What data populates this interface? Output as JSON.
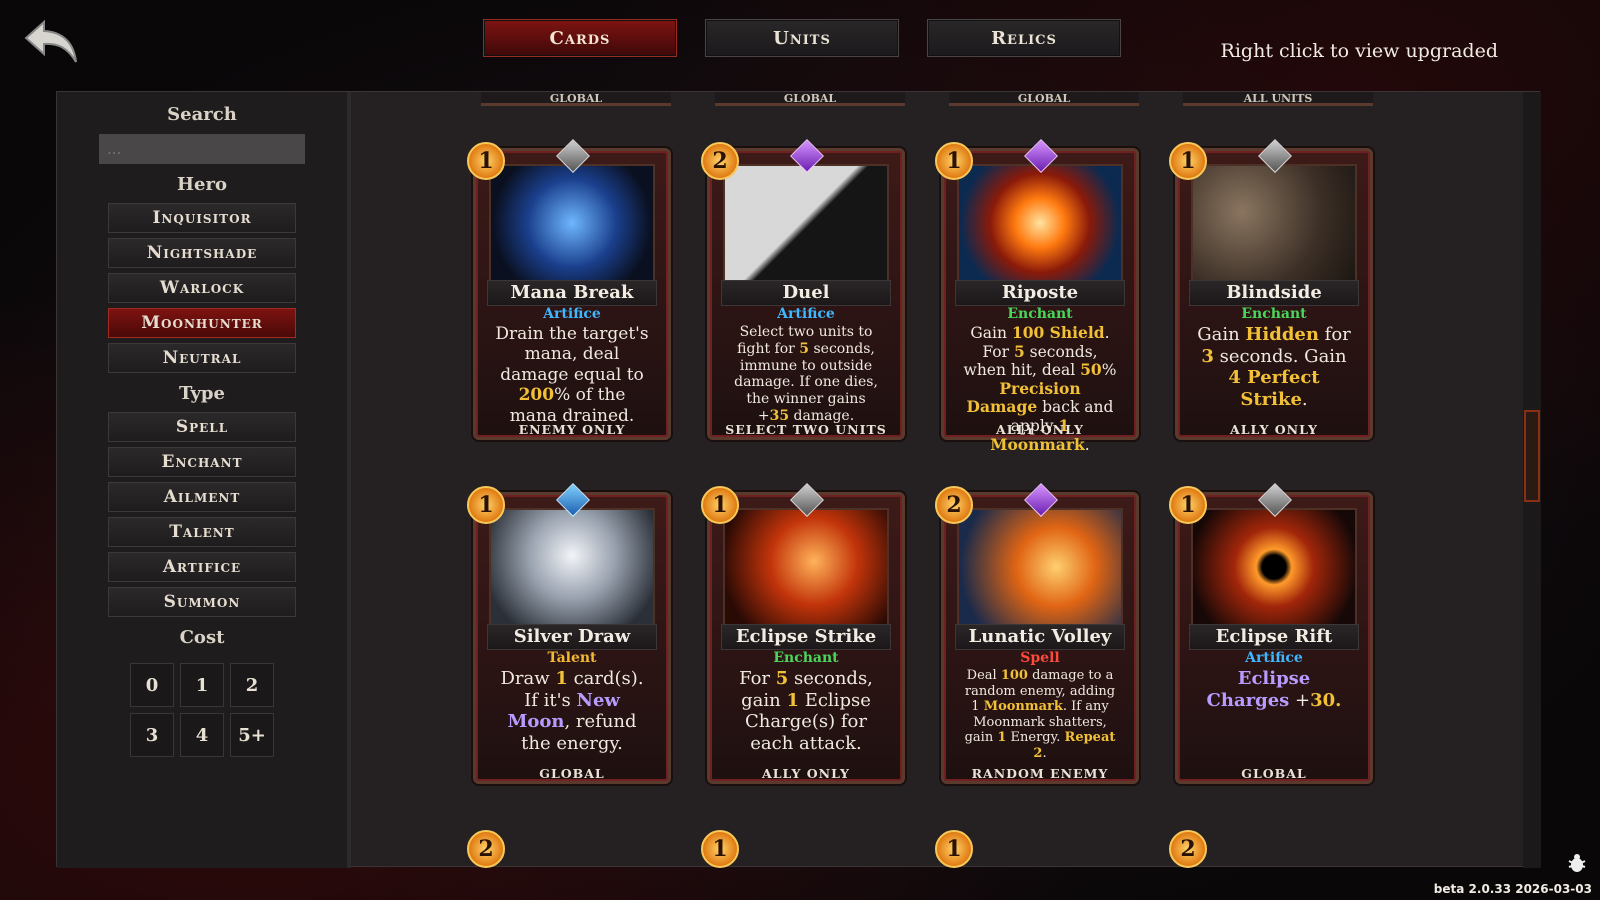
{
  "nav": {
    "tabs": [
      {
        "label": "Cards",
        "active": true
      },
      {
        "label": "Units",
        "active": false
      },
      {
        "label": "Relics",
        "active": false
      }
    ],
    "hint": "Right click to view upgraded"
  },
  "sidebar": {
    "search_label": "Search",
    "search_placeholder": "...",
    "hero_label": "Hero",
    "heroes": [
      "Inquisitor",
      "Nightshade",
      "Warlock",
      "Moonhunter",
      "Neutral"
    ],
    "active_hero": "Moonhunter",
    "type_label": "Type",
    "types": [
      "Spell",
      "Enchant",
      "Ailment",
      "Talent",
      "Artifice",
      "Summon"
    ],
    "cost_label": "Cost",
    "costs": [
      "0",
      "1",
      "2",
      "3",
      "4",
      "5+"
    ]
  },
  "partial_top_targets": [
    "GLOBAL",
    "GLOBAL",
    "GLOBAL",
    "ALL UNITS"
  ],
  "partial_bottom_costs": [
    "2",
    "1",
    "1",
    "2"
  ],
  "cards": [
    {
      "cost": "1",
      "gem": "grey",
      "name": "Mana Break",
      "type": "Artifice",
      "type_color": "#3fb7ff",
      "desc_parts": [
        "Drain the target's mana, deal damage equal to ",
        "200",
        "% of the mana drained."
      ],
      "target": "ENEMY ONLY"
    },
    {
      "cost": "2",
      "gem": "purple",
      "name": "Duel",
      "type": "Artifice",
      "type_color": "#3fb7ff",
      "desc_parts": [
        "Select two units to fight for ",
        "5",
        " seconds, immune to outside damage. If one dies, the winner gains +",
        "35",
        " damage."
      ],
      "target": "SELECT TWO UNITS"
    },
    {
      "cost": "1",
      "gem": "purple",
      "name": "Riposte",
      "type": "Enchant",
      "type_color": "#49d65a",
      "desc_parts": [
        "Gain ",
        "100 Shield",
        ". For ",
        "5",
        " seconds, when hit, deal ",
        "50",
        "% ",
        "Precision Damage",
        " back and apply ",
        "1 Moonmark",
        "."
      ],
      "target": "ALLY ONLY"
    },
    {
      "cost": "1",
      "gem": "grey",
      "name": "Blindside",
      "type": "Enchant",
      "type_color": "#49d65a",
      "desc_parts": [
        "Gain ",
        "Hidden",
        " for ",
        "3",
        " seconds. Gain ",
        "4 Perfect Strike",
        "."
      ],
      "target": "ALLY ONLY"
    },
    {
      "cost": "1",
      "gem": "blue",
      "name": "Silver Draw",
      "type": "Talent",
      "type_color": "#f2b933",
      "desc_parts": [
        "Draw ",
        "1",
        " card(s). If it's ",
        "New Moon",
        ", refund the energy."
      ],
      "target": "GLOBAL"
    },
    {
      "cost": "1",
      "gem": "grey",
      "name": "Eclipse Strike",
      "type": "Enchant",
      "type_color": "#49d65a",
      "desc_parts": [
        "For ",
        "5",
        " seconds, gain ",
        "1",
        " Eclipse Charge(s) for each attack."
      ],
      "target": "ALLY ONLY"
    },
    {
      "cost": "2",
      "gem": "purple",
      "name": "Lunatic Volley",
      "type": "Spell",
      "type_color": "#ff4a3a",
      "desc_parts": [
        "Deal ",
        "100",
        " damage to a random enemy, adding 1 ",
        "Moonmark",
        ". If any Moonmark shatters, gain ",
        "1",
        " Energy. ",
        "Repeat 2",
        "."
      ],
      "target": "RANDOM ENEMY"
    },
    {
      "cost": "1",
      "gem": "grey",
      "name": "Eclipse Rift",
      "type": "Artifice",
      "type_color": "#3fb7ff",
      "desc_parts": [
        "Eclipse Charges",
        " +",
        "30",
        "."
      ],
      "target": "GLOBAL"
    }
  ],
  "footer": {
    "version": "beta 2.0.33 2026-03-03"
  }
}
